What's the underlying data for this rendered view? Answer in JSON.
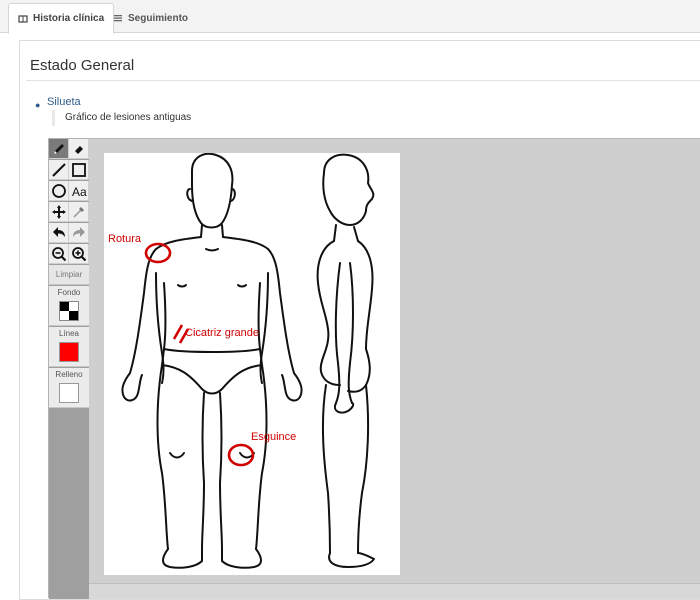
{
  "tabs": [
    {
      "label": "Historia clínica",
      "active": true,
      "icon": "book-icon"
    },
    {
      "label": "Seguimiento",
      "active": false,
      "icon": "list-icon"
    }
  ],
  "section": {
    "title": "Estado General"
  },
  "field": {
    "name": "Silueta",
    "description": "Gráfico de lesiones antiguas"
  },
  "toolbar": {
    "tools": [
      "pencil-icon",
      "eraser-icon",
      "line-icon",
      "rectangle-icon",
      "ellipse-icon",
      "text-icon",
      "move-icon",
      "eyedropper-icon",
      "undo-icon",
      "redo-icon",
      "zoom-out-icon",
      "zoom-in-icon"
    ],
    "clear_label": "Limpiar",
    "background_label": "Fondo",
    "line_label": "Línea",
    "fill_label": "Relleno",
    "line_color": "#ff0000",
    "fill_color": "#ffffff"
  },
  "annotations": {
    "rotura": "Rotura",
    "cicatriz": "Cicatriz grande",
    "esguince": "Esguince"
  },
  "colors": {
    "annotation": "#d10000",
    "link": "#2f5d8a"
  }
}
